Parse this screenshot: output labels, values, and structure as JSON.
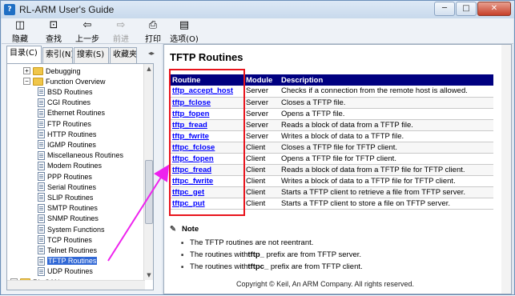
{
  "window": {
    "title": "RL-ARM User's Guide",
    "min": "─",
    "max": "□",
    "close": "✕"
  },
  "toolbar": [
    {
      "label": "隐藏",
      "icon": "◫",
      "name": "hide",
      "disabled": false
    },
    {
      "label": "查找",
      "icon": "⊡",
      "name": "find",
      "disabled": false
    },
    {
      "label": "上一步",
      "icon": "⇦",
      "name": "back",
      "disabled": false
    },
    {
      "label": "前进",
      "icon": "⇨",
      "name": "forward",
      "disabled": true
    },
    {
      "label": "打印",
      "icon": "⎙",
      "name": "print",
      "disabled": false
    },
    {
      "label": "选项(O)",
      "icon": "▤",
      "name": "options",
      "disabled": false
    }
  ],
  "tabs": [
    "目录(C)",
    "索引(N)",
    "搜索(S)",
    "收藏夹"
  ],
  "tree": [
    {
      "label": "Debugging",
      "type": "folder",
      "depth": 1,
      "pm": "+"
    },
    {
      "label": "Function Overview",
      "type": "folder",
      "depth": 1,
      "pm": "−"
    },
    {
      "label": "BSD Routines",
      "type": "page",
      "depth": 2
    },
    {
      "label": "CGI Routines",
      "type": "page",
      "depth": 2
    },
    {
      "label": "Ethernet Routines",
      "type": "page",
      "depth": 2
    },
    {
      "label": "FTP Routines",
      "type": "page",
      "depth": 2
    },
    {
      "label": "HTTP Routines",
      "type": "page",
      "depth": 2
    },
    {
      "label": "IGMP Routines",
      "type": "page",
      "depth": 2
    },
    {
      "label": "Miscellaneous  Routines",
      "type": "page",
      "depth": 2
    },
    {
      "label": "Modem Routines",
      "type": "page",
      "depth": 2
    },
    {
      "label": "PPP Routines",
      "type": "page",
      "depth": 2
    },
    {
      "label": "Serial Routines",
      "type": "page",
      "depth": 2
    },
    {
      "label": "SLIP Routines",
      "type": "page",
      "depth": 2
    },
    {
      "label": "SMTP Routines",
      "type": "page",
      "depth": 2
    },
    {
      "label": "SNMP Routines",
      "type": "page",
      "depth": 2
    },
    {
      "label": "System Functions",
      "type": "page",
      "depth": 2
    },
    {
      "label": "TCP Routines",
      "type": "page",
      "depth": 2
    },
    {
      "label": "Telnet Routines",
      "type": "page",
      "depth": 2
    },
    {
      "label": "TFTP Routines",
      "type": "page",
      "depth": 2,
      "selected": true
    },
    {
      "label": "UDP Routines",
      "type": "page",
      "depth": 2
    },
    {
      "label": "RL-CAN",
      "type": "folder",
      "depth": 0,
      "pm": "+"
    }
  ],
  "content": {
    "title": "TFTP Routines",
    "headers": [
      "Routine",
      "Module",
      "Description"
    ],
    "rows": [
      [
        "tftp_accept_host",
        "Server",
        "Checks if a connection from the remote host is allowed."
      ],
      [
        "tftp_fclose",
        "Server",
        "Closes a TFTP file."
      ],
      [
        "tftp_fopen",
        "Server",
        "Opens a TFTP file."
      ],
      [
        "tftp_fread",
        "Server",
        "Reads a block of data from a TFTP file."
      ],
      [
        "tftp_fwrite",
        "Server",
        "Writes a block of data to a TFTP file."
      ],
      [
        "tftpc_fclose",
        "Client",
        "Closes a TFTP file for TFTP client."
      ],
      [
        "tftpc_fopen",
        "Client",
        "Opens a TFTP file for TFTP client."
      ],
      [
        "tftpc_fread",
        "Client",
        "Reads a block of data from a TFTP file for TFTP client."
      ],
      [
        "tftpc_fwrite",
        "Client",
        "Writes a block of data to a TFTP file for TFTP client."
      ],
      [
        "tftpc_get",
        "Client",
        "Starts a TFTP client to retrieve a file from TFTP server."
      ],
      [
        "tftpc_put",
        "Client",
        "Starts a TFTP client to store a file on TFTP server."
      ]
    ],
    "note_title": "Note",
    "notes": [
      [
        "The TFTP routines are not reentrant.",
        "",
        ""
      ],
      [
        "The routines with ",
        "tftp_",
        " prefix are from TFTP server."
      ],
      [
        "The routines with ",
        "tftpc_",
        " prefix are from TFTP client."
      ]
    ],
    "copyright": "Copyright © Keil, An ARM Company. All rights reserved."
  },
  "colors": {
    "header_bg": "#000080",
    "link": "#0000ff",
    "highlight_box": "#e8141c",
    "arrow": "#ee22ee",
    "selection": "#3168d5"
  }
}
